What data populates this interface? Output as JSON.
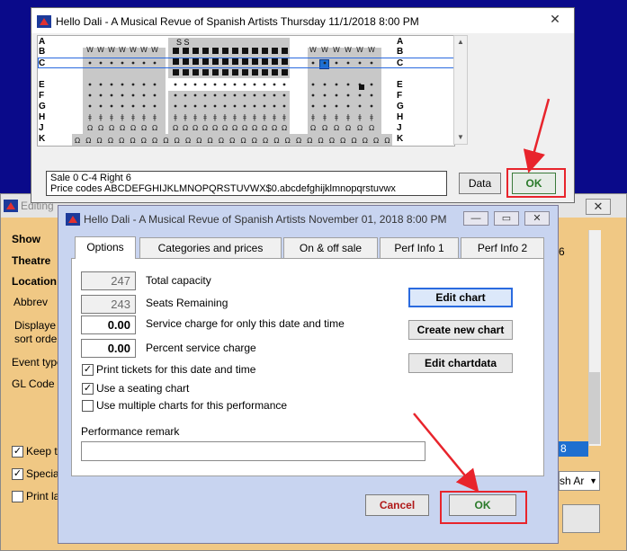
{
  "background_window": {
    "title": "Editing",
    "fields": [
      "Show",
      "Theatre",
      "Location",
      "Abbrev",
      "Displaye",
      "sort orde",
      "Event type",
      "GL Code"
    ],
    "checkboxes": [
      {
        "label": "Keep t",
        "checked": true
      },
      {
        "label": "Specia",
        "checked": true
      },
      {
        "label": "Print la",
        "checked": false
      }
    ],
    "right_fragment_1": "6",
    "right_fragment_2": "8",
    "dropdown_value": "sh Ar",
    "close_symbol": "✕"
  },
  "chart_window": {
    "title": "Hello Dali - A Musical Revue of Spanish Artists     Thursday 11/1/2018 8:00 PM",
    "rows_left": [
      "A",
      "B",
      "C",
      "",
      "E",
      "F",
      "G",
      "H",
      "J",
      "K"
    ],
    "rows_right": [
      "A",
      "B",
      "C",
      "",
      "E",
      "F",
      "G",
      "H",
      "J",
      "K"
    ],
    "status_line1": "Sale 0   C-4 Right 6",
    "status_line2": "Price codes ABCDEFGHIJKLMNOPQRSTUVWX$0.abcdefghijklmnopqrstuvwx",
    "data_button": "Data",
    "ok_button": "OK",
    "close_symbol": "✕",
    "seat_marks": {
      "row_a_section2": "S S",
      "row_b_section1": "W W",
      "wheel": "W",
      "row_j_mark": "Ω",
      "row_h_mark": "ǂ"
    }
  },
  "options_dialog": {
    "title": "Hello Dali - A Musical Revue of Spanish Artists November 01, 2018 8:00 PM",
    "tabs": [
      "Options",
      "Categories and prices",
      "On & off sale",
      "Perf Info 1",
      "Perf Info 2"
    ],
    "selected_tab": 0,
    "total_capacity": {
      "value": "247",
      "label": "Total capacity"
    },
    "seats_remaining": {
      "value": "243",
      "label": "Seats Remaining"
    },
    "service_charge": {
      "value": "0.00",
      "label": "Service charge for only this date and time"
    },
    "percent_service_charge": {
      "value": "0.00",
      "label": "Percent service charge"
    },
    "checkboxes": [
      {
        "label": "Print tickets for this date and time",
        "checked": true
      },
      {
        "label": "Use a seating chart",
        "checked": true
      },
      {
        "label": "Use multiple charts for this performance",
        "checked": false
      }
    ],
    "remark_label": "Performance remark",
    "remark_value": "",
    "buttons": {
      "edit_chart": "Edit chart",
      "create_chart": "Create new chart",
      "edit_chartdata": "Edit chartdata"
    },
    "cancel_button": "Cancel",
    "ok_button": "OK",
    "window_controls": {
      "minimize": "—",
      "maximize": "▭",
      "close": "✕"
    }
  },
  "colors": {
    "annotation": "#e8242c",
    "ok_text": "#2a7a2a",
    "cancel_text": "#b01818",
    "selected_seat": "#1e6fd0"
  }
}
